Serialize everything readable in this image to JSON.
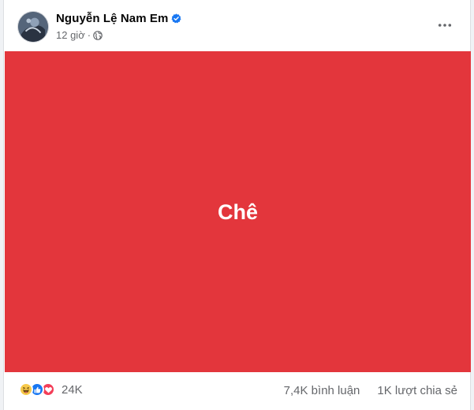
{
  "post": {
    "author": "Nguyễn Lệ Nam Em",
    "time": "12 giờ",
    "meta_separator": "·",
    "privacy_icon": "globe-icon",
    "verified_icon": "verified-badge-icon",
    "media_text": "Chê",
    "media_background": "#e3363c"
  },
  "footer": {
    "reactions": [
      "haha-icon",
      "like-icon",
      "love-icon"
    ],
    "reaction_count": "24K",
    "comments": "7,4K bình luận",
    "shares": "1K lượt chia sẻ"
  },
  "colors": {
    "text_primary": "#050505",
    "text_secondary": "#65676b",
    "brand_blue": "#1877f2",
    "love_red": "#f33e58",
    "haha_yellow": "#f7c94b"
  }
}
